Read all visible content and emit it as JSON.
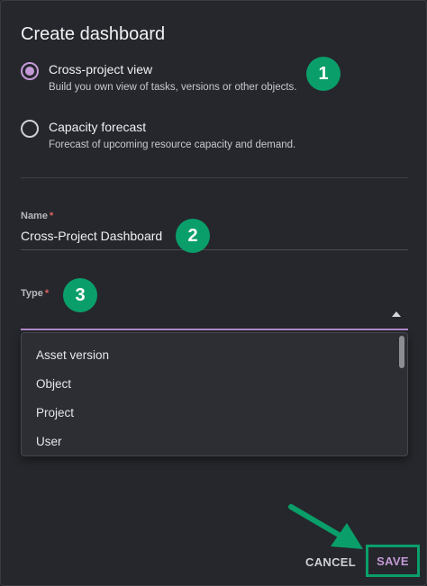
{
  "dialog": {
    "title": "Create dashboard",
    "options": [
      {
        "label": "Cross-project view",
        "description": "Build you own view of tasks, versions or other objects.",
        "selected": true
      },
      {
        "label": "Capacity forecast",
        "description": "Forecast of upcoming resource capacity and demand.",
        "selected": false
      }
    ],
    "name_field": {
      "label": "Name",
      "required_mark": "*",
      "value": "Cross-Project Dashboard"
    },
    "type_field": {
      "label": "Type",
      "required_mark": "*",
      "value": "",
      "options": [
        "Asset version",
        "Object",
        "Project",
        "User"
      ]
    },
    "buttons": {
      "cancel": "CANCEL",
      "save": "SAVE"
    }
  },
  "annotations": {
    "step1": "1",
    "step2": "2",
    "step3": "3"
  },
  "colors": {
    "accent": "#c39ad8",
    "annotation_green": "#0a9f6a",
    "background": "#25272c",
    "required": "#e0625f"
  },
  "icons": {
    "type_dropdown_caret": "caret-up-icon",
    "annotation_arrow": "arrow-icon"
  }
}
